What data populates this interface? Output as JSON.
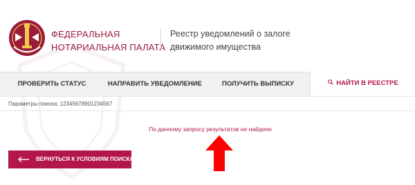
{
  "header": {
    "org_name_line1": "ФЕДЕРАЛЬНАЯ",
    "org_name_line2": "НОТАРИАЛЬНАЯ ПАЛАТА",
    "registry_line1": "Реестр уведомлений о залоге",
    "registry_line2": "движимого имущества",
    "logo_icon": "notary-emblem-icon"
  },
  "tabs": [
    {
      "label": "ПРОВЕРИТЬ СТАТУС",
      "active": false
    },
    {
      "label": "НАПРАВИТЬ УВЕДОМЛЕНИЕ",
      "active": false
    },
    {
      "label": "ПОЛУЧИТЬ ВЫПИСКУ",
      "active": false
    },
    {
      "label": "НАЙТИ В РЕЕСТРЕ",
      "active": true,
      "icon": "search-icon"
    }
  ],
  "search": {
    "params_text": "Параметры поиска: 12345678901234567"
  },
  "result": {
    "message": "По данному запросу результатов не найдено"
  },
  "actions": {
    "back_label": "ВЕРНУТЬСЯ К УСЛОВИЯМ ПОИСКА",
    "back_icon": "arrow-left-icon"
  },
  "annotation": {
    "icon": "red-arrow-up-icon",
    "color": "#ff0000"
  },
  "colors": {
    "accent": "#b3164a",
    "brand_text": "#9b1b3b",
    "tab_bar": "#f1f1f1"
  }
}
